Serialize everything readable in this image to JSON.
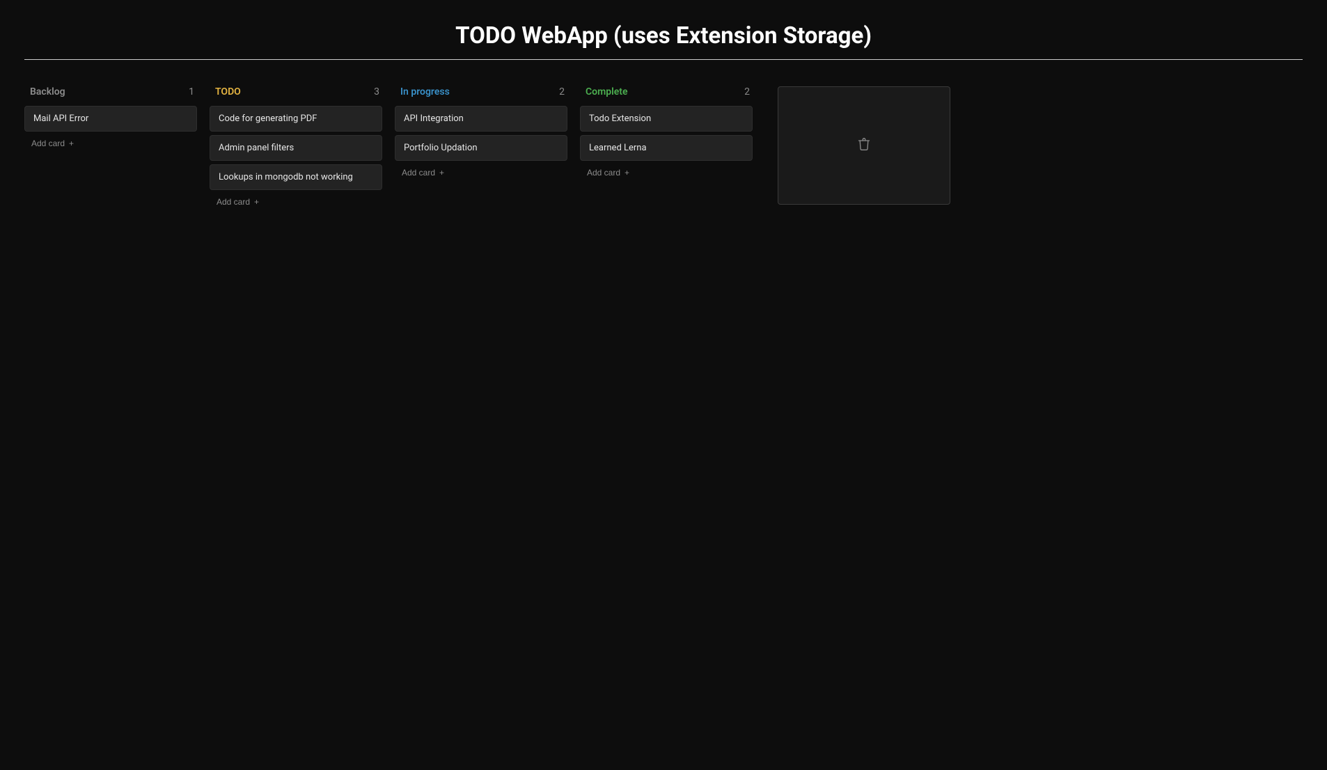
{
  "title": "TODO WebApp (uses Extension Storage)",
  "add_card_label": "Add card",
  "columns": [
    {
      "key": "backlog",
      "title": "Backlog",
      "color_class": "c-backlog",
      "count": "1",
      "cards": [
        "Mail API Error"
      ]
    },
    {
      "key": "todo",
      "title": "TODO",
      "color_class": "c-todo",
      "count": "3",
      "cards": [
        "Code for generating PDF",
        "Admin panel filters",
        "Lookups in mongodb not working"
      ]
    },
    {
      "key": "in-progress",
      "title": "In progress",
      "color_class": "c-progress",
      "count": "2",
      "cards": [
        "API Integration",
        "Portfolio Updation"
      ]
    },
    {
      "key": "complete",
      "title": "Complete",
      "color_class": "c-complete",
      "count": "2",
      "cards": [
        "Todo Extension",
        "Learned Lerna"
      ]
    }
  ],
  "trash": {
    "icon": "trash-icon"
  }
}
